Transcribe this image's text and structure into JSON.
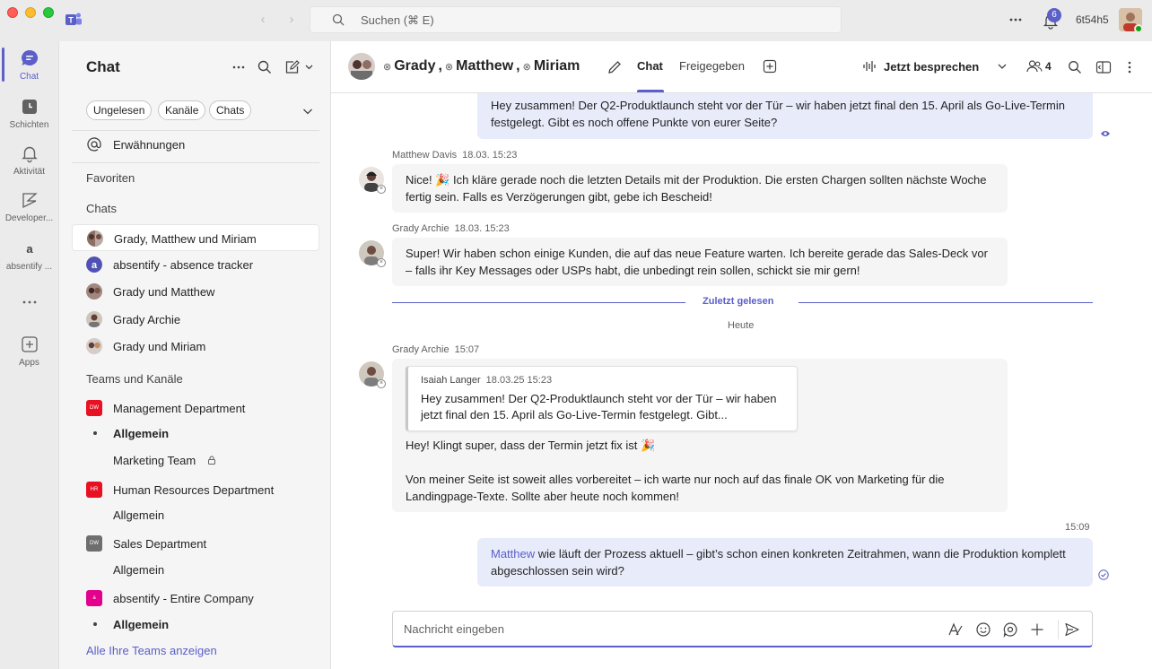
{
  "titlebar": {
    "search_placeholder": "Suchen (⌘ E)",
    "notifications_badge": "6",
    "user_name": "6t54h5"
  },
  "rail": {
    "items": [
      {
        "label": "Chat",
        "icon": "chat-icon"
      },
      {
        "label": "Schichten",
        "icon": "shifts-icon"
      },
      {
        "label": "Aktivität",
        "icon": "bell-icon"
      },
      {
        "label": "Developer...",
        "icon": "developer-icon"
      },
      {
        "label": "absentify ...",
        "icon": "absentify-icon"
      },
      {
        "label": "Apps",
        "icon": "add-app-icon"
      }
    ]
  },
  "leftpane": {
    "title": "Chat",
    "filters": [
      "Ungelesen",
      "Kanäle",
      "Chats"
    ],
    "mentions": "Erwähnungen",
    "favorites_heading": "Favoriten",
    "chats_heading": "Chats",
    "chats": [
      "Grady, Matthew und Miriam",
      "absentify - absence tracker",
      "Grady und Matthew",
      "Grady Archie",
      "Grady und Miriam"
    ],
    "teams_heading": "Teams und Kanäle",
    "teams": [
      {
        "name": "Management Department",
        "abbr": "DW",
        "color": "#e81123",
        "channels": [
          "Allgemein",
          "Marketing Team"
        ]
      },
      {
        "name": "Human Resources Department",
        "abbr": "HR",
        "color": "#e81123",
        "channels": [
          "Allgemein"
        ]
      },
      {
        "name": "Sales Department",
        "abbr": "DW",
        "color": "#6e6e6e",
        "channels": [
          "Allgemein"
        ]
      },
      {
        "name": "absentify - Entire Company",
        "abbr": "a",
        "color": "#e3008c",
        "channels": [
          "Allgemein"
        ]
      }
    ],
    "show_all_teams": "Alle Ihre Teams anzeigen"
  },
  "header": {
    "participants": [
      "Grady",
      "Matthew",
      "Miriam"
    ],
    "tabs": [
      "Chat",
      "Freigegeben"
    ],
    "meet_label": "Jetzt besprechen",
    "people_count": "4"
  },
  "messages": {
    "first_mine": "Hey zusammen! Der Q2-Produktlaunch steht vor der Tür – wir haben jetzt final den 15. April als Go-Live-Termin festgelegt. Gibt es noch offene Punkte von eurer Seite?",
    "m1": {
      "author": "Matthew Davis",
      "time": "18.03. 15:23",
      "text_before": "Nice! ",
      "text_after": " Ich kläre gerade noch die letzten Details mit der Produktion. Die ersten Chargen sollten nächste Woche fertig sein. Falls es Verzögerungen gibt, gebe ich Bescheid!"
    },
    "m2": {
      "author": "Grady Archie",
      "time": "18.03. 15:23",
      "text": "Super! Wir haben schon einige Kunden, die auf das neue Feature warten. Ich bereite gerade das Sales-Deck vor – falls ihr Key Messages oder USPs habt, die unbedingt rein sollen, schickt sie mir gern!"
    },
    "last_read": "Zuletzt gelesen",
    "today": "Heute",
    "m3": {
      "author": "Grady Archie",
      "time": "15:07",
      "quote_author": "Isaiah Langer",
      "quote_time": "18.03.25 15:23",
      "quote_text": "Hey zusammen! Der Q2-Produktlaunch steht vor der Tür – wir haben jetzt final den 15. April als Go-Live-Termin festgelegt. Gibt...",
      "line1": "Hey! Klingt super, dass der Termin jetzt fix ist ",
      "line2": "Von meiner Seite ist soweit alles vorbereitet – ich warte nur noch auf das finale OK von Marketing für die Landingpage-Texte. Sollte aber heute noch kommen!"
    },
    "m4": {
      "time": "15:09",
      "mention": "Matthew",
      "text": " wie läuft der Prozess aktuell – gibt’s schon einen konkreten Zeitrahmen, wann die Produktion komplett abgeschlossen sein wird?"
    }
  },
  "compose": {
    "placeholder": "Nachricht eingeben"
  }
}
